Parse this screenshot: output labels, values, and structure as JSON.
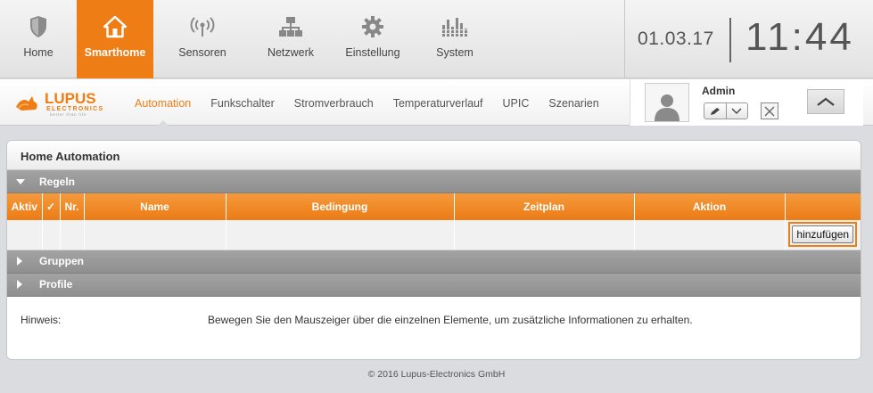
{
  "topnav": {
    "items": [
      {
        "label": "Home",
        "icon": "shield-icon",
        "active": false
      },
      {
        "label": "Smarthome",
        "icon": "house-icon",
        "active": true
      },
      {
        "label": "Sensoren",
        "icon": "signal-icon",
        "active": false
      },
      {
        "label": "Netzwerk",
        "icon": "network-icon",
        "active": false
      },
      {
        "label": "Einstellung",
        "icon": "gear-icon",
        "active": false
      },
      {
        "label": "System",
        "icon": "equalizer-icon",
        "active": false
      }
    ],
    "date": "01.03.17",
    "time": "11:44"
  },
  "logo": {
    "text": "LUPUS",
    "subtext": "ELECTRONICS",
    "tagline": "better than life"
  },
  "subnav": {
    "items": [
      {
        "label": "Automation",
        "active": true
      },
      {
        "label": "Funkschalter",
        "active": false
      },
      {
        "label": "Stromverbrauch",
        "active": false
      },
      {
        "label": "Temperaturverlauf",
        "active": false
      },
      {
        "label": "UPIC",
        "active": false
      },
      {
        "label": "Szenarien",
        "active": false
      }
    ]
  },
  "user": {
    "name": "Admin"
  },
  "panel": {
    "title": "Home Automation",
    "sections": {
      "rules": "Regeln",
      "groups": "Gruppen",
      "profiles": "Profile"
    },
    "table": {
      "columns": [
        "Aktiv",
        "✓",
        "Nr.",
        "Name",
        "Bedingung",
        "Zeitplan",
        "Aktion",
        ""
      ],
      "add_button": "hinzufügen"
    },
    "hint": {
      "label": "Hinweis:",
      "text": "Bewegen Sie den Mauszeiger über die einzelnen Elemente, um zusätzliche Informationen zu erhalten."
    }
  },
  "footer": "© 2016 Lupus-Electronics GmbH",
  "colors": {
    "accent": "#ef7d16",
    "section_gray": "#999999",
    "background": "#dadcdf"
  }
}
